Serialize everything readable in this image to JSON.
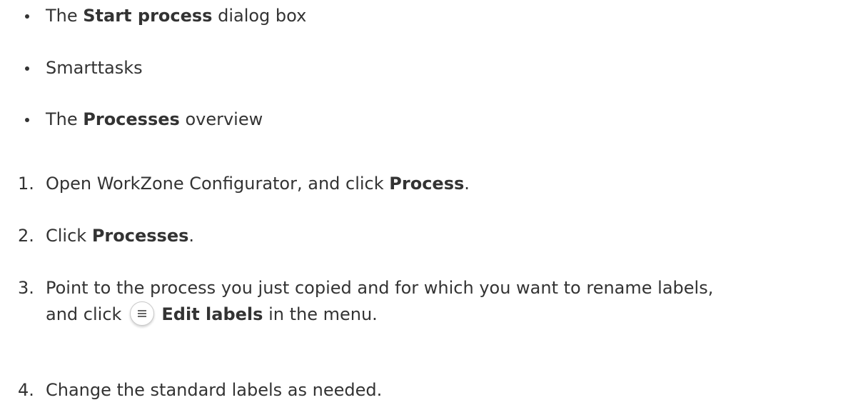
{
  "bullets": [
    {
      "pre": "The ",
      "bold": "Start process",
      "post": " dialog box"
    },
    {
      "pre": "Smarttasks",
      "bold": "",
      "post": ""
    },
    {
      "pre": "The ",
      "bold": "Processes",
      "post": " overview"
    }
  ],
  "steps": [
    {
      "num": "1.",
      "pre": "Open WorkZone Configurator, and click ",
      "bold": "Process",
      "post": "."
    },
    {
      "num": "2.",
      "pre": "Click ",
      "bold": "Processes",
      "post": "."
    },
    {
      "num": "3.",
      "pre": "Point to the process you just copied and for which you want to rename labels,",
      "cont_pre": "and click",
      "bold": "Edit labels",
      "post": " in the menu."
    },
    {
      "num": "4.",
      "pre": "Change the standard labels as needed.",
      "bold": "",
      "post": ""
    }
  ],
  "icons": {
    "menu": "hamburger-menu-icon"
  }
}
